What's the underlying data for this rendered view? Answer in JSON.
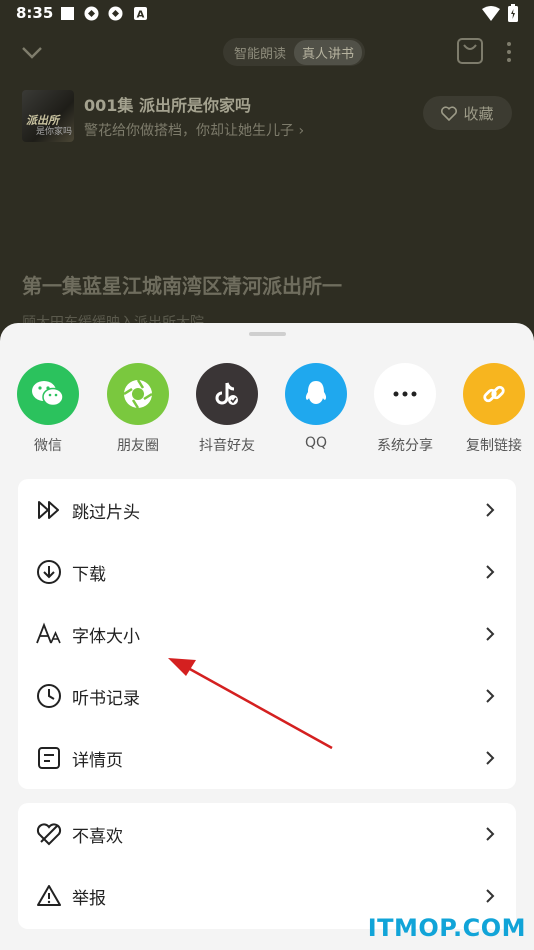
{
  "status": {
    "time": "8:35",
    "right": "▼◢▮"
  },
  "header": {
    "mode_tabs": [
      "智能朗读",
      "真人讲书"
    ],
    "active_tab": 1
  },
  "book": {
    "episode": "001集 派出所是你家吗",
    "subtitle": "警花给你做搭档，你却让她生儿子 ›",
    "cover_title": "派出所",
    "cover_sub": "是你家吗",
    "favorite": "收藏"
  },
  "chapter": {
    "title": "第一集蓝星江城南湾区清河派出所一",
    "line2": "顾大田东缓缓映入派出所大院"
  },
  "share_items": [
    {
      "label": "微信",
      "icon": "wechat-icon",
      "color": "#2bc25d"
    },
    {
      "label": "朋友圈",
      "icon": "moments-icon",
      "color": "#7ac83e"
    },
    {
      "label": "抖音好友",
      "icon": "douyin-icon",
      "color": "#3a3536"
    },
    {
      "label": "QQ",
      "icon": "qq-icon",
      "color": "#1fa8ee"
    },
    {
      "label": "系统分享",
      "icon": "more-share-icon",
      "color": "#ffffff"
    },
    {
      "label": "复制链接",
      "icon": "link-icon",
      "color": "#f7b51f"
    }
  ],
  "menu1": [
    {
      "label": "跳过片头",
      "icon": "skip-intro-icon"
    },
    {
      "label": "下载",
      "icon": "download-icon"
    },
    {
      "label": "字体大小",
      "icon": "font-size-icon"
    },
    {
      "label": "听书记录",
      "icon": "history-icon"
    },
    {
      "label": "详情页",
      "icon": "details-icon"
    }
  ],
  "menu2": [
    {
      "label": "不喜欢",
      "icon": "dislike-icon"
    },
    {
      "label": "举报",
      "icon": "report-icon"
    }
  ],
  "watermark": "ITMOP.COM",
  "colors": {
    "sheet_bg": "#f4f4f4",
    "player_bg": "#2e2d22",
    "annotation_arrow": "#d42020",
    "watermark": "#11a4d8"
  }
}
